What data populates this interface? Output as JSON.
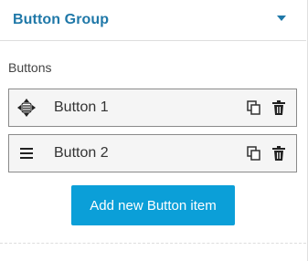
{
  "panel": {
    "title": "Button Group",
    "accent_color": "#1f78a8",
    "collapse_icon": "caret-down-icon"
  },
  "section": {
    "label": "Buttons"
  },
  "items": [
    {
      "label": "Button 1",
      "handle_icon": "move-arrows-icon",
      "actions": [
        "duplicate-icon",
        "trash-icon"
      ]
    },
    {
      "label": "Button 2",
      "handle_icon": "hamburger-icon",
      "actions": [
        "duplicate-icon",
        "trash-icon"
      ]
    }
  ],
  "add_button": {
    "label": "Add new Button item",
    "color": "#0b9fd8"
  }
}
